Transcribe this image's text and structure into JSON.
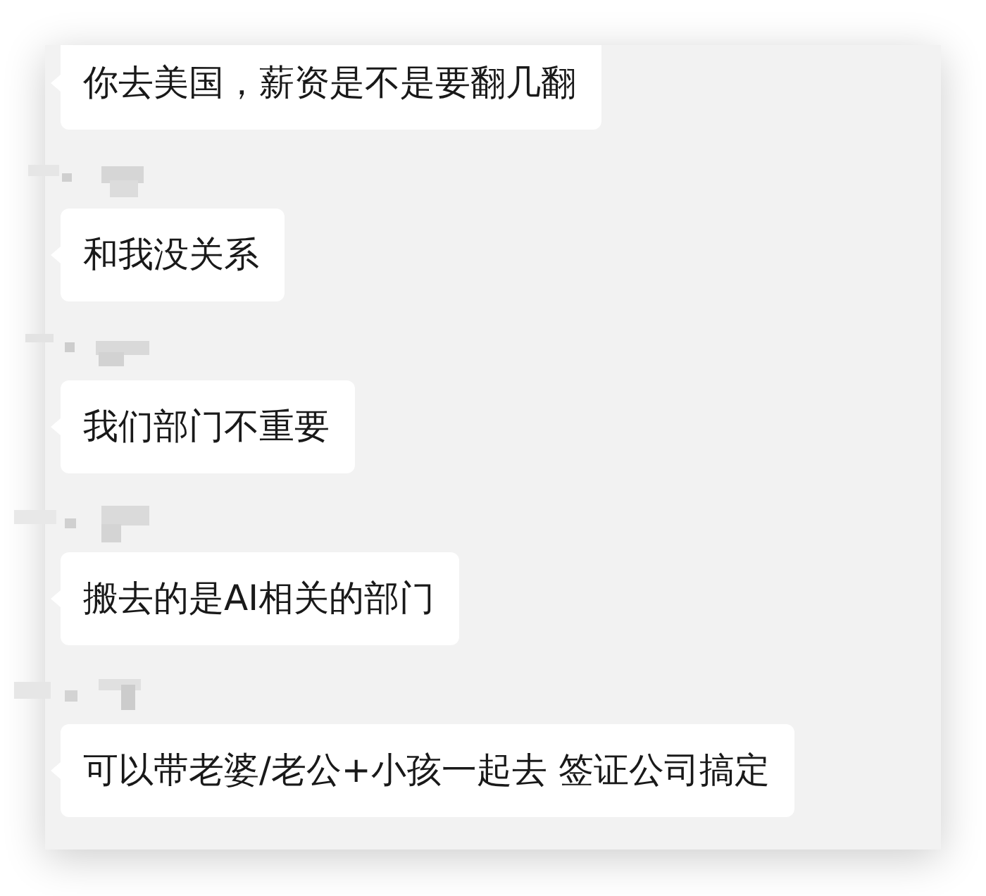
{
  "chat": {
    "items": [
      {
        "kind": "message",
        "text": "你去美国，薪资是不是要翻几翻"
      },
      {
        "kind": "redacted_name"
      },
      {
        "kind": "message",
        "text": "和我没关系"
      },
      {
        "kind": "redacted_name"
      },
      {
        "kind": "message",
        "text": "我们部门不重要"
      },
      {
        "kind": "redacted_name"
      },
      {
        "kind": "message",
        "text": "搬去的是AI相关的部门"
      },
      {
        "kind": "redacted_name"
      },
      {
        "kind": "message",
        "text": "可以带老婆/老公+小孩一起去 签证公司搞定"
      }
    ]
  }
}
